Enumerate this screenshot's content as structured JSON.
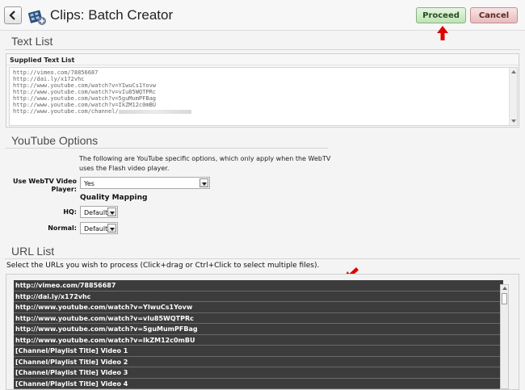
{
  "header": {
    "title": "Clips: Batch Creator",
    "proceed_label": "Proceed",
    "cancel_label": "Cancel",
    "back_icon": "chevron-left-icon",
    "app_icon": "film-clip-icon"
  },
  "text_list": {
    "section_title": "Text List",
    "panel_label": "Supplied Text List",
    "lines": [
      "http://vimeo.com/78856687",
      "http://dai.ly/x172vhc",
      "http://www.youtube.com/watch?v=YIwuCs1Yovw",
      "http://www.youtube.com/watch?v=vIu85WQTPRc",
      "http://www.youtube.com/watch?v=5guMumPFBag",
      "http://www.youtube.com/watch?v=IkZM12c0mBU",
      "http://www.youtube.com/channel/"
    ]
  },
  "youtube_options": {
    "section_title": "YouTube Options",
    "description": "The following are YouTube specific options, which only apply when the WebTV uses the Flash video player.",
    "player_label": "Use WebTV Video Player:",
    "player_value": "Yes",
    "quality_heading": "Quality Mapping",
    "hq_label": "HQ:",
    "hq_value": "Default",
    "normal_label": "Normal:",
    "normal_value": "Default"
  },
  "url_list": {
    "section_title": "URL List",
    "instructions": "Select the URLs you wish to process (Click+drag or Ctrl+Click to select multiple files).",
    "items": [
      "http://vimeo.com/78856687",
      "http://dai.ly/x172vhc",
      "http://www.youtube.com/watch?v=YIwuCs1Yovw",
      "http://www.youtube.com/watch?v=vIu85WQTPRc",
      "http://www.youtube.com/watch?v=5guMumPFBag",
      "http://www.youtube.com/watch?v=IkZM12c0mBU",
      "[Channel/Playlist Title] Video 1",
      "[Channel/Playlist Title] Video 2",
      "[Channel/Playlist Title] Video 3",
      "[Channel/Playlist Title] Video 4"
    ]
  },
  "colors": {
    "proceed_bg": "#bfe3b6",
    "cancel_bg": "#e8bcbc",
    "annotation_arrow": "#e00000",
    "selected_row_bg": "#3c3c3c"
  }
}
